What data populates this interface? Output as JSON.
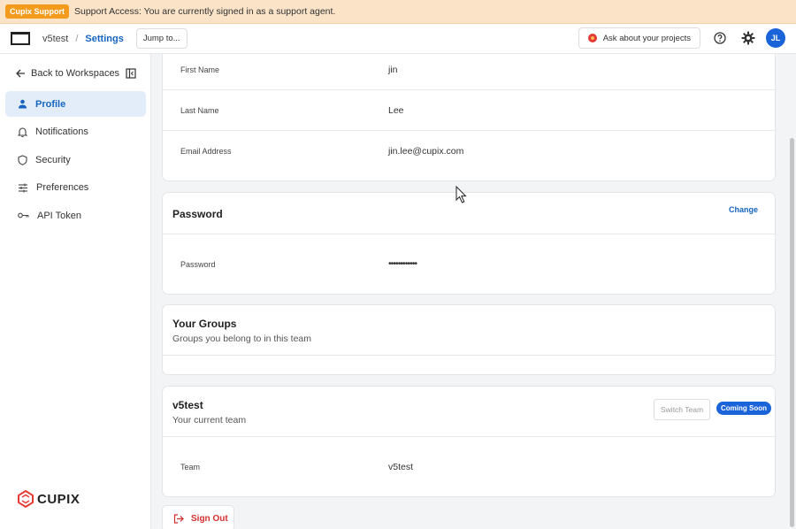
{
  "banner": {
    "badge": "Cupix Support",
    "text": "Support Access: You are currently signed in as a support agent."
  },
  "topbar": {
    "workspace": "v5test",
    "separator": "/",
    "current": "Settings",
    "jump_label": "Jump to...",
    "ask_label": "Ask about your projects",
    "avatar_initials": "JL"
  },
  "sidebar": {
    "back_label": "Back to Workspaces",
    "items": [
      {
        "label": "Profile",
        "icon": "person-icon",
        "active": true
      },
      {
        "label": "Notifications",
        "icon": "bell-icon"
      },
      {
        "label": "Security",
        "icon": "shield-icon"
      },
      {
        "label": "Preferences",
        "icon": "sliders-icon"
      },
      {
        "label": "API Token",
        "icon": "key-icon"
      }
    ],
    "brand": "CUPIX"
  },
  "profile": {
    "first_name_label": "First Name",
    "first_name_value": "jin",
    "last_name_label": "Last Name",
    "last_name_value": "Lee",
    "email_label": "Email Address",
    "email_value": "jin.lee@cupix.com"
  },
  "password": {
    "title": "Password",
    "change_label": "Change",
    "label": "Password",
    "value": "••••••••••••"
  },
  "groups": {
    "title": "Your Groups",
    "subtitle": "Groups you belong to in this team"
  },
  "team": {
    "title": "v5test",
    "subtitle": "Your current team",
    "switch_label": "Switch Team",
    "soon_label": "Coming Soon",
    "team_label": "Team",
    "team_value": "v5test"
  },
  "signout_label": "Sign Out",
  "colors": {
    "accent": "#1565c0",
    "banner": "#fbe3c8",
    "badge": "#f29b1d",
    "danger": "#d32f2f"
  }
}
